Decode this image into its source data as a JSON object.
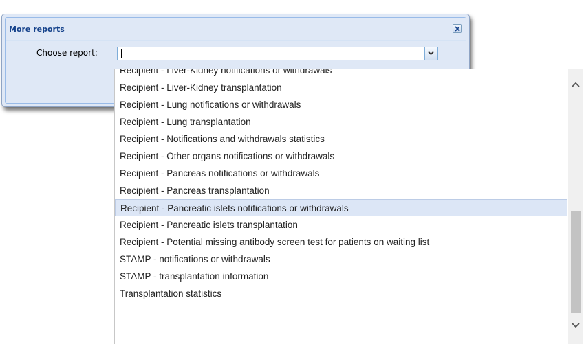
{
  "dialog": {
    "title": "More reports",
    "field_label": "Choose report:",
    "combo_value": ""
  },
  "dropdown": {
    "items": [
      "Recipient - Liver-Kidney notifications or withdrawals",
      "Recipient - Liver-Kidney transplantation",
      "Recipient - Lung notifications or withdrawals",
      "Recipient - Lung transplantation",
      "Recipient - Notifications and withdrawals statistics",
      "Recipient - Other organs notifications or withdrawals",
      "Recipient - Pancreas notifications or withdrawals",
      "Recipient - Pancreas transplantation",
      "Recipient - Pancreatic islets notifications or withdrawals",
      "Recipient - Pancreatic islets transplantation",
      "Recipient - Potential missing antibody screen test for patients on waiting list",
      "STAMP - notifications or withdrawals",
      "STAMP - transplantation information",
      "Transplantation statistics"
    ],
    "selected_index": 8
  }
}
